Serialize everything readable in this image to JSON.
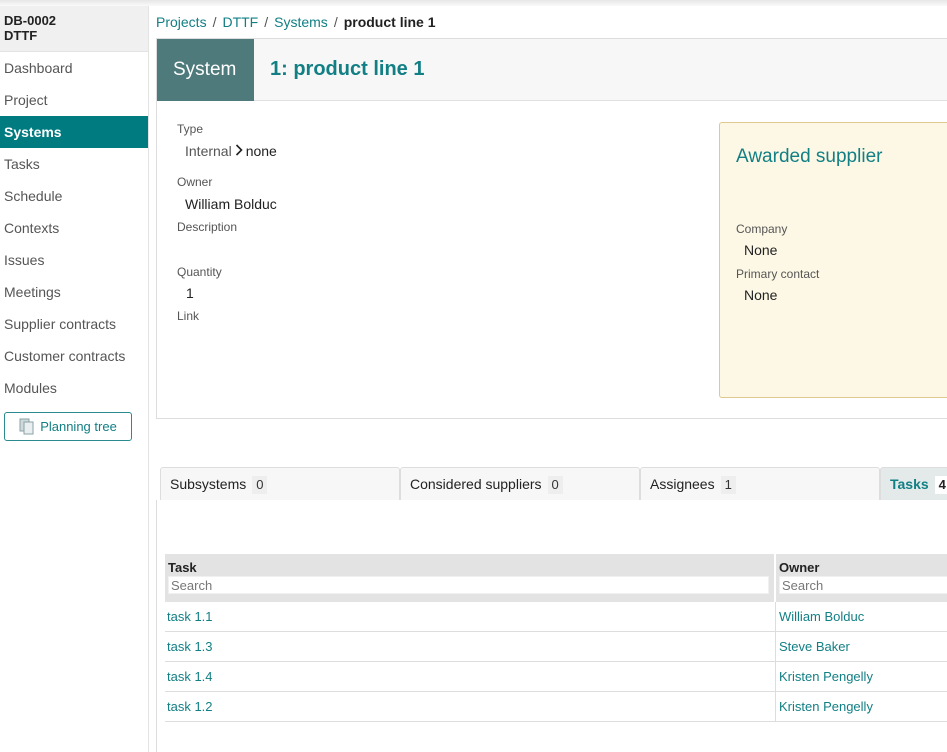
{
  "project": {
    "code": "DB-0002",
    "name": "DTTF"
  },
  "nav": {
    "items": [
      "Dashboard",
      "Project",
      "Systems",
      "Tasks",
      "Schedule",
      "Contexts",
      "Issues",
      "Meetings",
      "Supplier contracts",
      "Customer contracts",
      "Modules"
    ],
    "active": "Systems",
    "planning_tree_label": "Planning tree"
  },
  "breadcrumb": {
    "items": [
      "Projects",
      "DTTF",
      "Systems"
    ],
    "current": "product line 1",
    "separator": "/"
  },
  "system": {
    "label": "System",
    "title": "1: product line 1",
    "type_label": "Type",
    "type_value": "Internal",
    "type_sub": "none",
    "owner_label": "Owner",
    "owner_value": "William Bolduc",
    "description_label": "Description",
    "quantity_label": "Quantity",
    "quantity_value": "1",
    "link_label": "Link"
  },
  "supplier": {
    "title": "Awarded supplier",
    "company_label": "Company",
    "company_value": "None",
    "contact_label": "Primary contact",
    "contact_value": "None"
  },
  "tabs": [
    {
      "label": "Subsystems",
      "count": "0"
    },
    {
      "label": "Considered suppliers",
      "count": "0"
    },
    {
      "label": "Assignees",
      "count": "1"
    },
    {
      "label": "Tasks",
      "count": "4"
    }
  ],
  "table": {
    "columns": [
      "Task",
      "Owner"
    ],
    "search_placeholder": "Search",
    "rows": [
      {
        "task": "task 1.1",
        "owner": "William Bolduc"
      },
      {
        "task": "task 1.3",
        "owner": "Steve Baker"
      },
      {
        "task": "task 1.4",
        "owner": "Kristen Pengelly"
      },
      {
        "task": "task 1.2",
        "owner": "Kristen Pengelly"
      }
    ]
  },
  "colors": {
    "accent": "#127f84",
    "active_nav": "#007b80",
    "system_label_bg": "#4e7a7b",
    "supplier_bg": "#fdf8e6"
  }
}
